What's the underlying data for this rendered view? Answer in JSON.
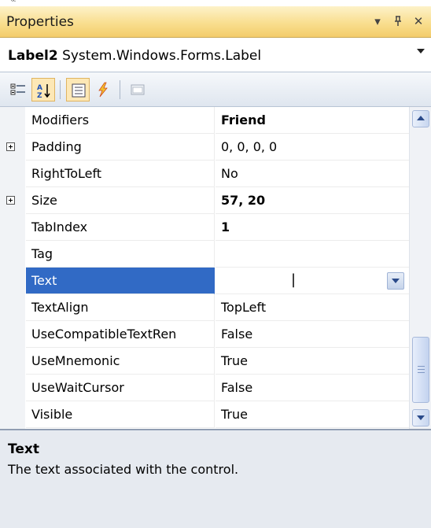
{
  "window": {
    "title": "Properties"
  },
  "selector": {
    "object_name": "Label2",
    "object_type": "System.Windows.Forms.Label"
  },
  "toolbar": {
    "buttons": [
      {
        "icon": "categorized-icon",
        "checked": false
      },
      {
        "icon": "alphabetical-icon",
        "checked": true
      },
      {
        "icon": "properties-icon",
        "checked": true
      },
      {
        "icon": "events-lightning-icon",
        "checked": false
      },
      {
        "icon": "property-pages-icon",
        "checked": false
      }
    ]
  },
  "grid": {
    "selected_index": 6,
    "rows": [
      {
        "name": "Modifiers",
        "value": "Friend",
        "bold": true,
        "expandable": false
      },
      {
        "name": "Padding",
        "value": "0, 0, 0, 0",
        "bold": false,
        "expandable": true
      },
      {
        "name": "RightToLeft",
        "value": "No",
        "bold": false,
        "expandable": false
      },
      {
        "name": "Size",
        "value": "57, 20",
        "bold": true,
        "expandable": true
      },
      {
        "name": "TabIndex",
        "value": "1",
        "bold": true,
        "expandable": false
      },
      {
        "name": "Tag",
        "value": "",
        "bold": false,
        "expandable": false
      },
      {
        "name": "Text",
        "value": "",
        "bold": false,
        "expandable": false
      },
      {
        "name": "TextAlign",
        "value": "TopLeft",
        "bold": false,
        "expandable": false
      },
      {
        "name": "UseCompatibleTextRen",
        "value": "False",
        "bold": false,
        "expandable": false
      },
      {
        "name": "UseMnemonic",
        "value": "True",
        "bold": false,
        "expandable": false
      },
      {
        "name": "UseWaitCursor",
        "value": "False",
        "bold": false,
        "expandable": false
      },
      {
        "name": "Visible",
        "value": "True",
        "bold": false,
        "expandable": false
      }
    ]
  },
  "description": {
    "title": "Text",
    "text": "The text associated with the control."
  },
  "colors": {
    "selection": "#316ac5",
    "titlebar": "#f9de8f"
  }
}
